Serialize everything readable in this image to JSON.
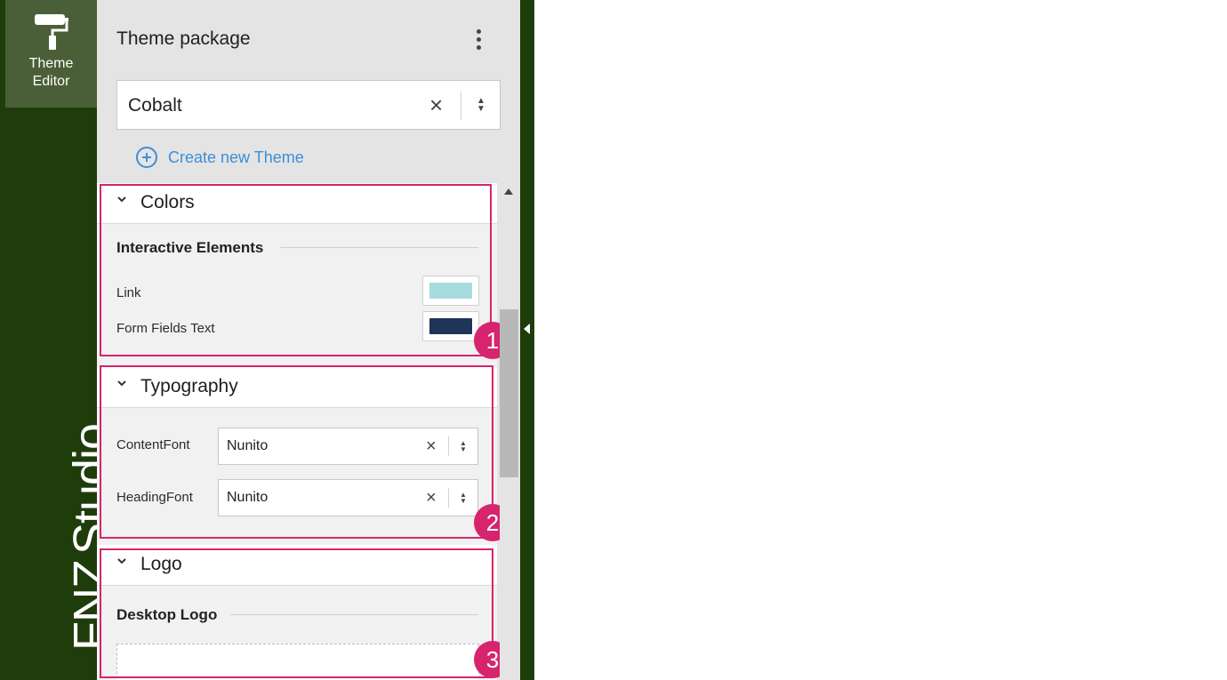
{
  "app": {
    "nav_item_label_line1": "Theme",
    "nav_item_label_line2": "Editor",
    "nav_icon": "paint-roller-icon",
    "brand_part1": "FNZ",
    "brand_part2": "Studio"
  },
  "panel": {
    "title": "Theme package",
    "menu_icon": "kebab-menu-icon",
    "theme_select": {
      "value": "Cobalt",
      "clear_glyph": "×",
      "arrows_glyph": "▲▼"
    },
    "create_link": "Create new Theme"
  },
  "sections": {
    "colors": {
      "title": "Colors",
      "subheading": "Interactive Elements",
      "rows": [
        {
          "label": "Link",
          "color": "#a6dcde"
        },
        {
          "label": "Form Fields Text",
          "color": "#1e3557"
        }
      ]
    },
    "typography": {
      "title": "Typography",
      "rows": [
        {
          "label": "ContentFont",
          "value": "Nunito"
        },
        {
          "label": "HeadingFont",
          "value": "Nunito"
        }
      ]
    },
    "logo": {
      "title": "Logo",
      "subheading": "Desktop Logo"
    }
  },
  "callouts": [
    "1",
    "2",
    "3"
  ],
  "colors": {
    "rail": "#1e3d0b",
    "rail_active": "#4a5f37",
    "accent_link": "#3b8fd9",
    "callout": "#d6246e"
  }
}
